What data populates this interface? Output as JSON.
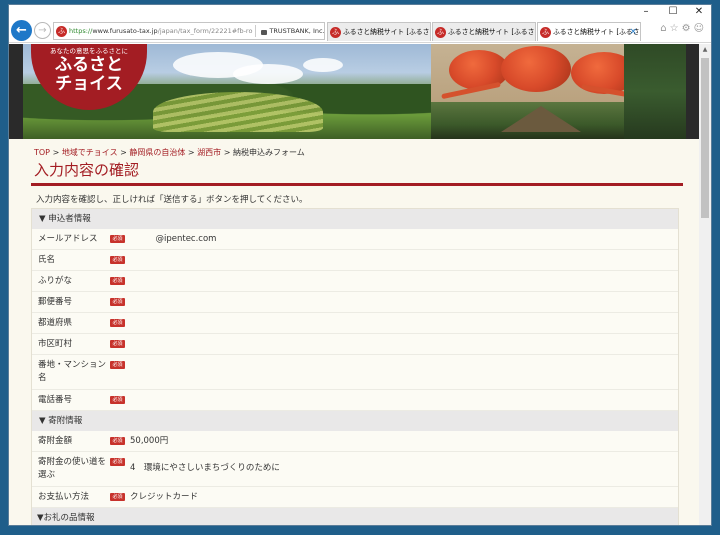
{
  "browser": {
    "window_controls": {
      "minimize": "–",
      "maximize": "☐",
      "close": "✕"
    },
    "address": {
      "scheme": "https://",
      "host": "www.furusato-tax.jp",
      "path": "/japan/tax_form/22221#fb-ro",
      "cert": "TRUSTBANK, Inc. [JP]",
      "refresh": "↻"
    },
    "tabs": [
      {
        "label": "ふるさと納税サイト [ふるさとチョイ..."
      },
      {
        "label": "ふるさと納税サイト [ふるさとチョイ..."
      },
      {
        "label": "ふるさと納税サイト [ふるさとチ..."
      }
    ],
    "toolbar_icons": "⌂☆⚙☺"
  },
  "banner": {
    "logo_tagline": "あなたの意思をふるさとに",
    "logo_line1": "ふるさと",
    "logo_line2": "チョイス"
  },
  "breadcrumb": {
    "items": [
      "TOP",
      "地域でチョイス",
      "静岡県の自治体",
      "湖西市"
    ],
    "current": "納税申込みフォーム",
    "separator": ">"
  },
  "page": {
    "title": "入力内容の確認",
    "intro": "入力内容を確認し、正しければ「送信する」ボタンを押してください。"
  },
  "required_badge": "必須",
  "sections": {
    "applicant": {
      "title": "▼ 申込者情報",
      "rows": [
        {
          "label": "メールアドレス",
          "value": "　　　@ipentec.com"
        },
        {
          "label": "氏名",
          "value": ""
        },
        {
          "label": "ふりがな",
          "value": ""
        },
        {
          "label": "郵便番号",
          "value": ""
        },
        {
          "label": "都道府県",
          "value": ""
        },
        {
          "label": "市区町村",
          "value": ""
        },
        {
          "label": "番地・マンション名",
          "value": ""
        },
        {
          "label": "電話番号",
          "value": ""
        }
      ]
    },
    "donation": {
      "title": "▼ 寄附情報",
      "rows": [
        {
          "label": "寄附金額",
          "value": "50,000円"
        },
        {
          "label": "寄附金の使い道を選ぶ",
          "value": "4　環境にやさしいまちづくりのために"
        },
        {
          "label": "お支払い方法",
          "value": "クレジットカード"
        }
      ]
    },
    "gift": {
      "title": "▼お礼の品情報"
    }
  },
  "colors": {
    "brand_red": "#a31d23",
    "badge_red": "#c7322b",
    "page_bg": "#faf8ee"
  }
}
